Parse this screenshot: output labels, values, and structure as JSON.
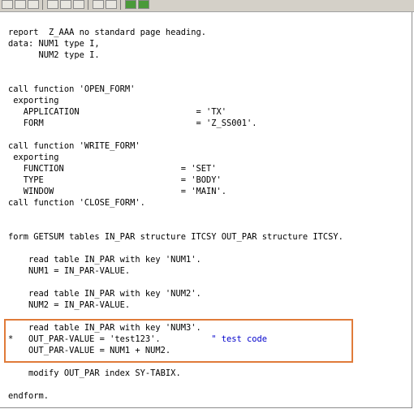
{
  "toolbar": {
    "buttons": [
      "save-icon",
      "copy-icon",
      "paste-icon",
      "undo-icon",
      "redo-icon",
      "print-icon",
      "find-icon",
      "upload-icon",
      "download-icon"
    ]
  },
  "code": {
    "lines": [
      "report  Z_AAA no standard page heading.",
      "data: NUM1 type I,",
      "      NUM2 type I.",
      "call function 'OPEN_FORM'",
      " exporting",
      "   APPLICATION                       = 'TX'",
      "   FORM                              = 'Z_SS001'.",
      "call function 'WRITE_FORM'",
      " exporting",
      "   FUNCTION                       = 'SET'",
      "   TYPE                           = 'BODY'",
      "   WINDOW                         = 'MAIN'.",
      "call function 'CLOSE_FORM'.",
      "form GETSUM tables IN_PAR structure ITCSY OUT_PAR structure ITCSY.",
      "    read table IN_PAR with key 'NUM1'.",
      "    NUM1 = IN_PAR-VALUE.",
      "    read table IN_PAR with key 'NUM2'.",
      "    NUM2 = IN_PAR-VALUE.",
      "    read table IN_PAR with key 'NUM3'.",
      "*   OUT_PAR-VALUE = 'test123'.          ",
      "    OUT_PAR-VALUE = NUM1 + NUM2.",
      "    modify OUT_PAR index SY-TABIX.",
      "endform."
    ],
    "comment_text": "\" test code"
  },
  "colors": {
    "highlight_border": "#e07b39",
    "comment": "#0000cc",
    "toolbar_bg": "#d4d0c8"
  }
}
